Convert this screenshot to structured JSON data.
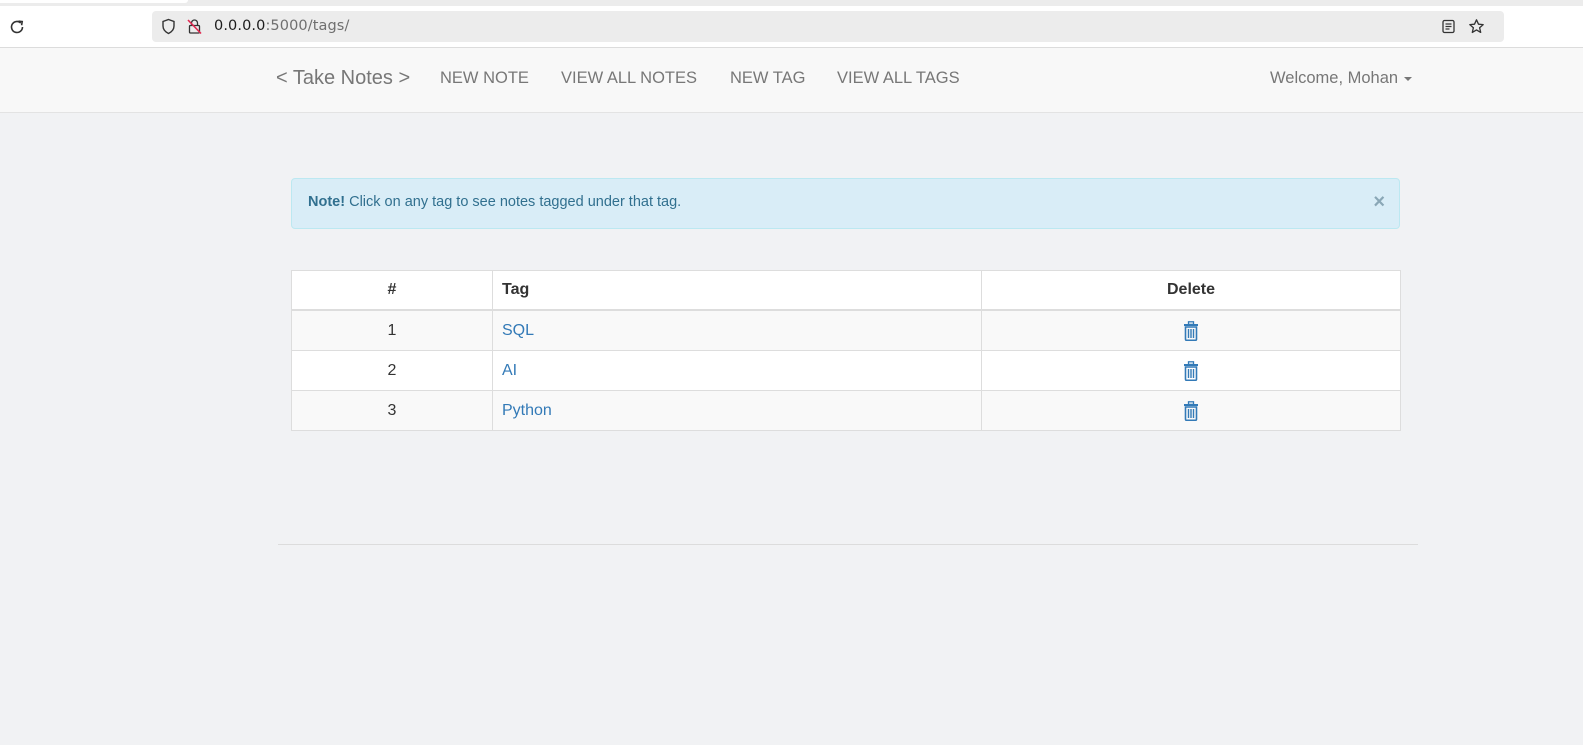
{
  "browser": {
    "url_host": "0.0.0.0",
    "url_rest": ":5000/tags/",
    "icons": [
      "reload-icon",
      "shield-icon",
      "insecure-lock-icon",
      "reader-view-icon",
      "bookmark-star-icon"
    ]
  },
  "navbar": {
    "brand": "< Take Notes >",
    "links": [
      "NEW NOTE",
      "VIEW ALL NOTES",
      "NEW TAG",
      "VIEW ALL TAGS"
    ],
    "welcome": "Welcome, Mohan"
  },
  "alert": {
    "title": "Note!",
    "message": "Click on any tag to see notes tagged under that tag.",
    "close": "×"
  },
  "table": {
    "headers": [
      "#",
      "Tag",
      "Delete"
    ],
    "rows": [
      {
        "num": "1",
        "tag": "SQL"
      },
      {
        "num": "2",
        "tag": "AI"
      },
      {
        "num": "3",
        "tag": "Python"
      }
    ]
  },
  "colors": {
    "link": "#337ab7",
    "alert_bg": "#d9edf7",
    "alert_text": "#31708f",
    "navbar_bg": "#f8f8f8",
    "page_bg": "#f1f2f4"
  }
}
